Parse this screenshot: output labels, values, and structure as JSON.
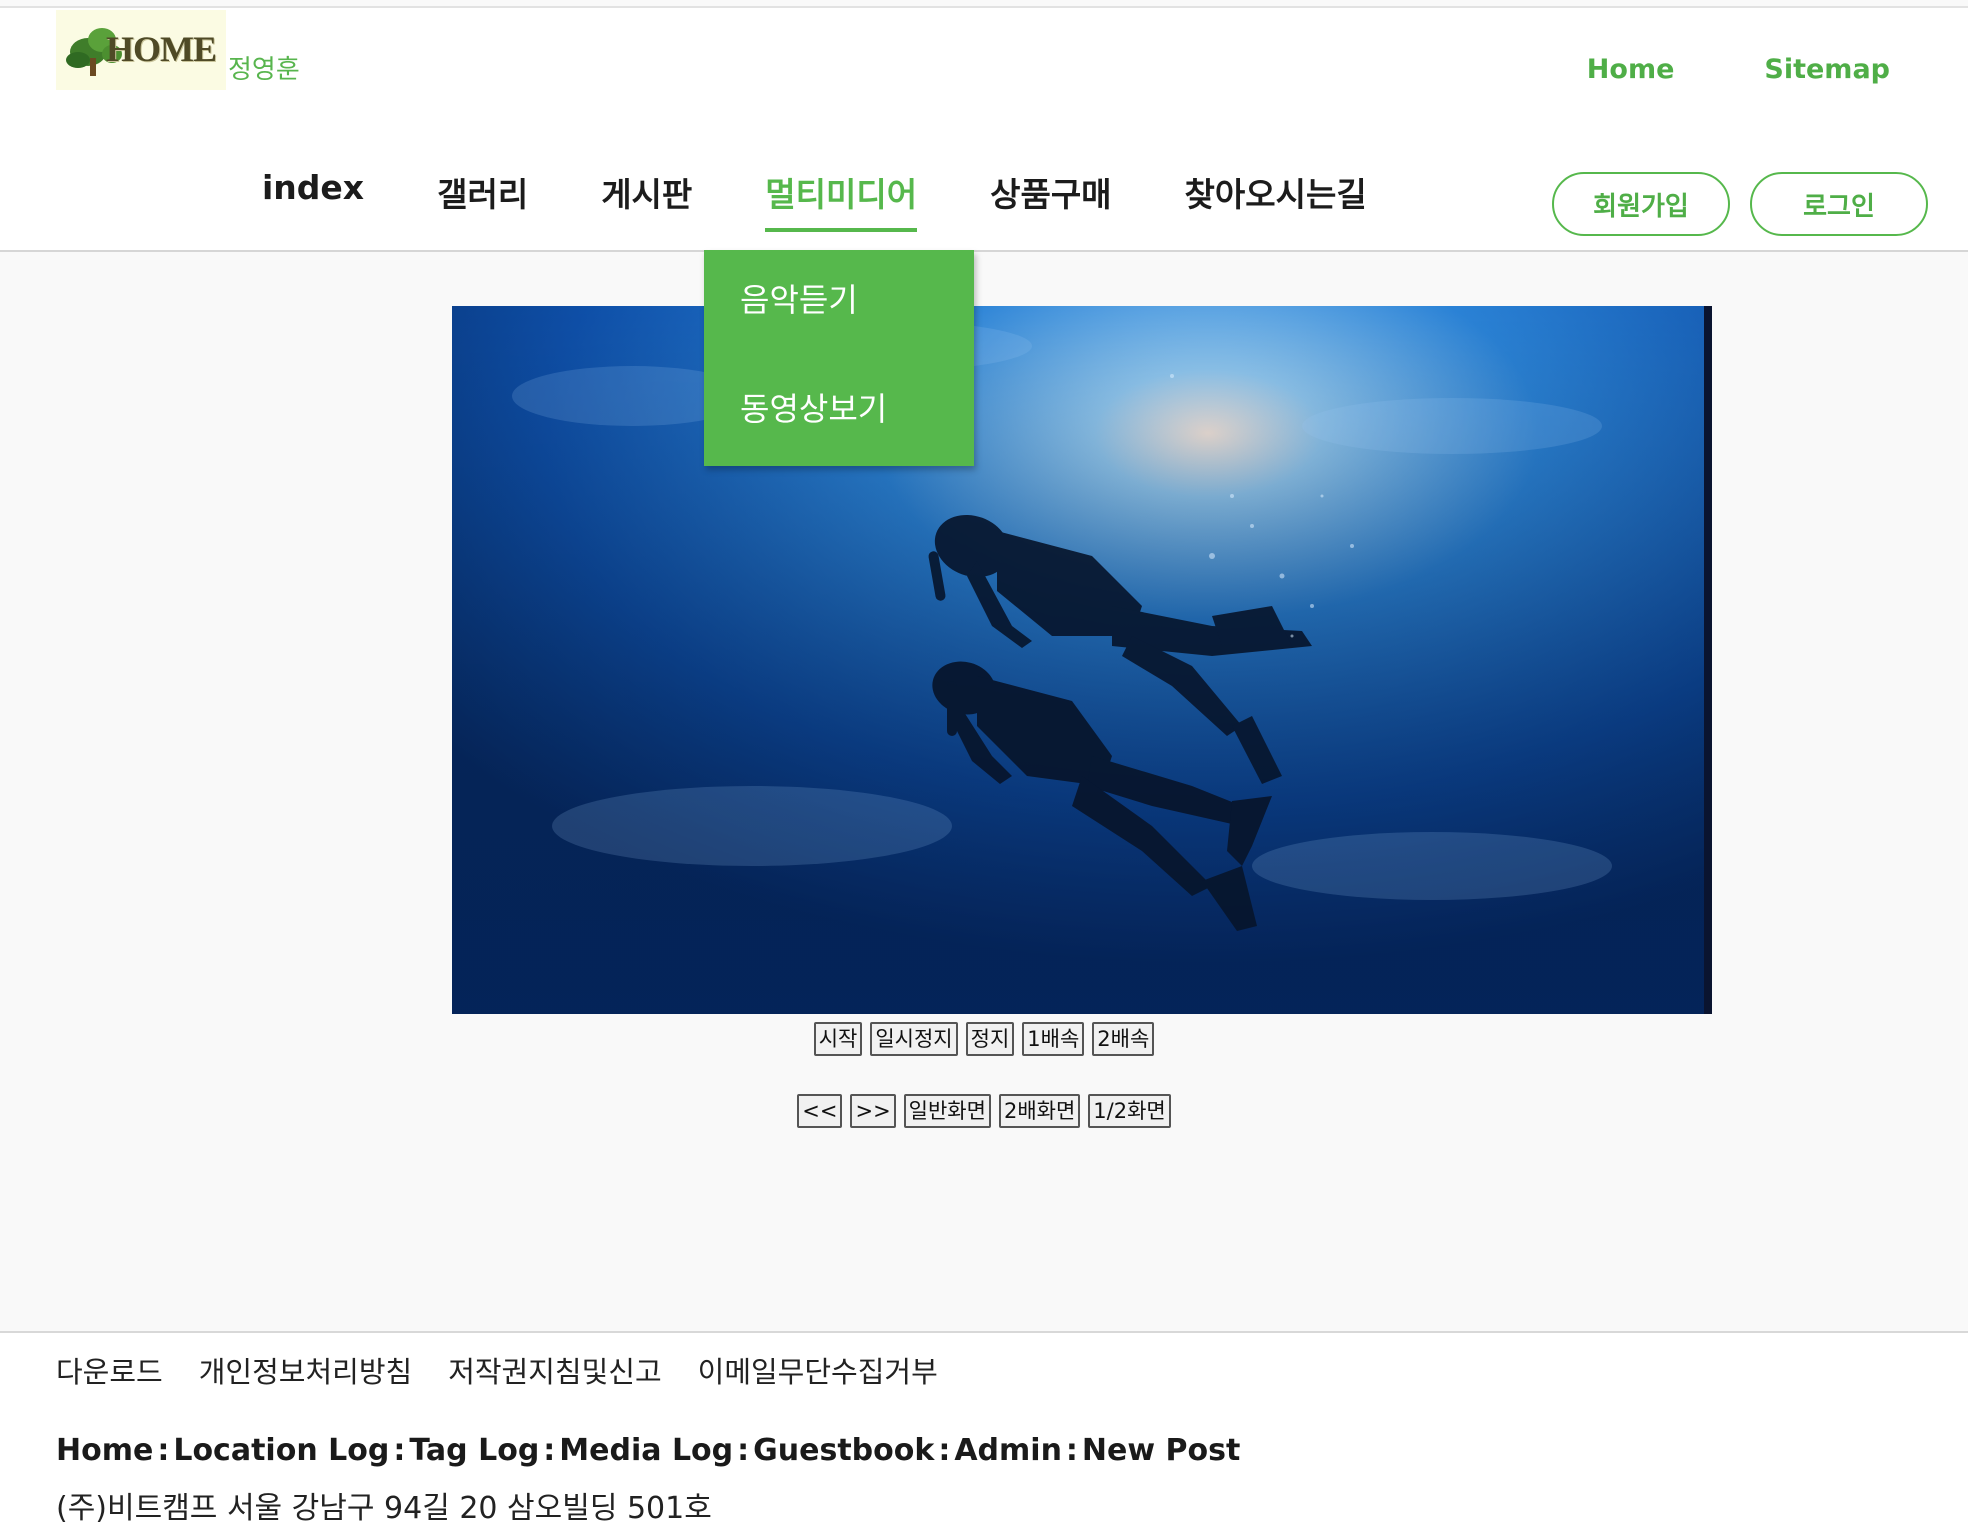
{
  "header": {
    "logo_text": "HOME",
    "owner_name": "정영훈",
    "util_links": [
      "Home",
      "Sitemap"
    ]
  },
  "nav": {
    "items": [
      "index",
      "갤러리",
      "게시판",
      "멀티미디어",
      "상품구매",
      "찾아오시는길"
    ],
    "active_index": 3,
    "signup_label": "회원가입",
    "login_label": "로그인"
  },
  "dropdown": {
    "items": [
      "음악듣기",
      "동영상보기"
    ]
  },
  "player": {
    "row1": [
      "시작",
      "일시정지",
      "정지",
      "1배속",
      "2배속"
    ],
    "row2": [
      "<<",
      ">>",
      "일반화면",
      "2배화면",
      "1/2화면"
    ]
  },
  "footer": {
    "links": [
      "다운로드",
      "개인정보처리방침",
      "저작권지침및신고",
      "이메일무단수집거부"
    ],
    "blog_links": [
      "Home",
      "Location Log",
      "Tag Log",
      "Media Log",
      "Guestbook",
      "Admin",
      "New Post"
    ],
    "blog_separator": ":",
    "address": "(주)비트캠프 서울 강남구 94길 20 삼오빌딩 501호"
  },
  "colors": {
    "accent": "#56b84c",
    "video_water": "#0b3f92"
  }
}
